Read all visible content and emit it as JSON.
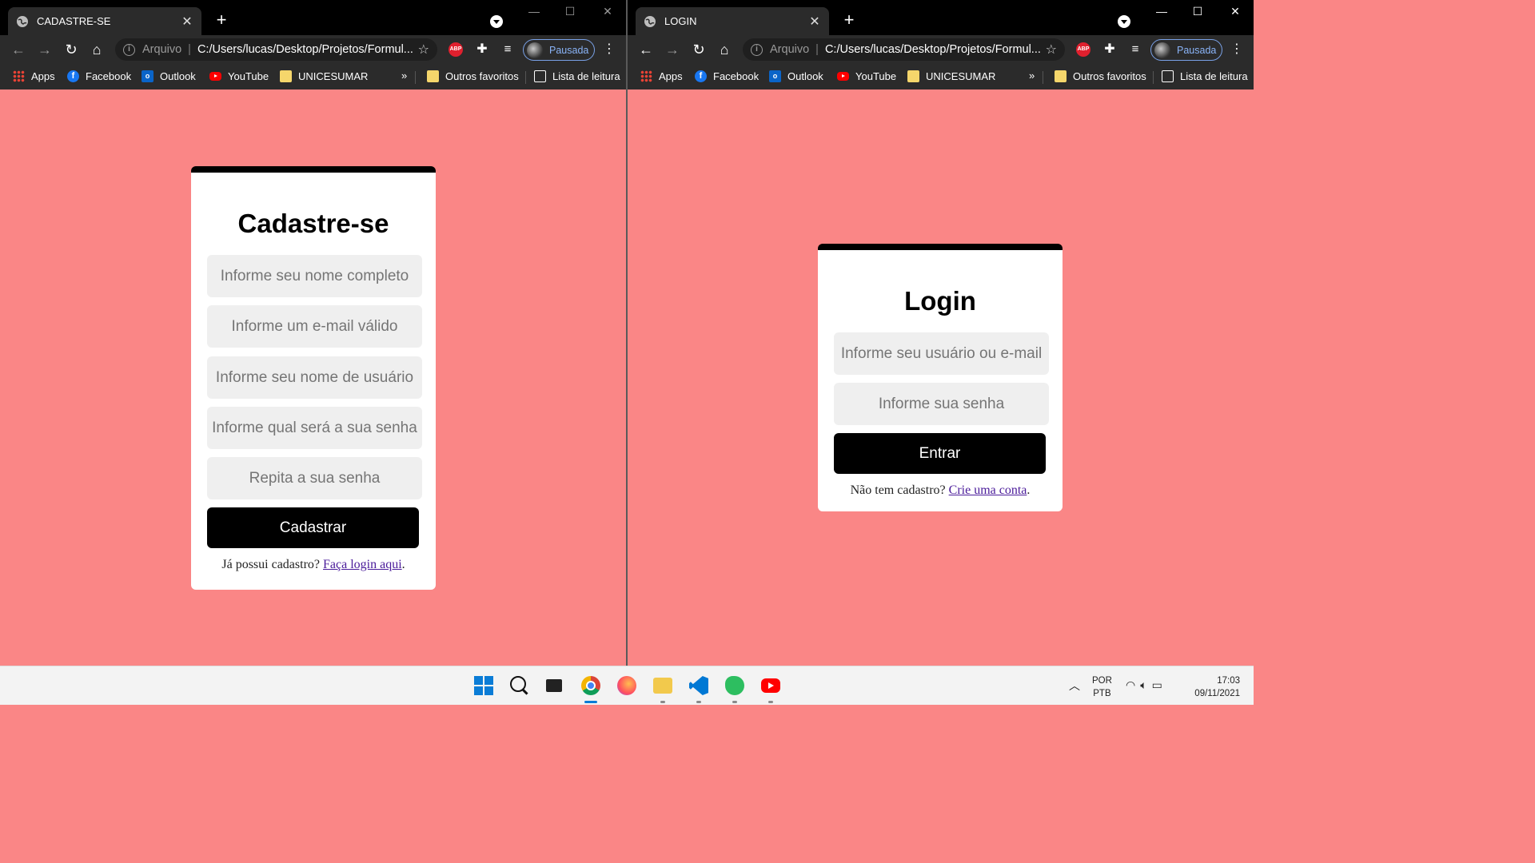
{
  "left_window": {
    "tab_title": "CADASTRE-SE",
    "address": {
      "scheme": "Arquivo",
      "url": "C:/Users/lucas/Desktop/Projetos/Formul..."
    },
    "profile_label": "Pausada",
    "bookmarks": [
      "Apps",
      "Facebook",
      "Outlook",
      "YouTube",
      "UNICESUMAR"
    ],
    "bookmarks_more": "»",
    "other_bookmarks": "Outros favoritos",
    "reading_list": "Lista de leitura",
    "form": {
      "title": "Cadastre-se",
      "fields": [
        {
          "placeholder": "Informe seu nome completo"
        },
        {
          "placeholder": "Informe um e-mail válido"
        },
        {
          "placeholder": "Informe seu nome de usuário"
        },
        {
          "placeholder": "Informe qual será a sua senha"
        },
        {
          "placeholder": "Repita a sua senha"
        }
      ],
      "submit_label": "Cadastrar",
      "footer_text": "Já possui cadastro? ",
      "footer_link": "Faça login aqui",
      "footer_end": "."
    }
  },
  "right_window": {
    "tab_title": "LOGIN",
    "address": {
      "scheme": "Arquivo",
      "url": "C:/Users/lucas/Desktop/Projetos/Formul..."
    },
    "profile_label": "Pausada",
    "bookmarks": [
      "Apps",
      "Facebook",
      "Outlook",
      "YouTube",
      "UNICESUMAR"
    ],
    "bookmarks_more": "»",
    "other_bookmarks": "Outros favoritos",
    "reading_list": "Lista de leitura",
    "form": {
      "title": "Login",
      "fields": [
        {
          "placeholder": "Informe seu usuário ou e-mail"
        },
        {
          "placeholder": "Informe sua senha"
        }
      ],
      "submit_label": "Entrar",
      "footer_text": "Não tem cadastro? ",
      "footer_link": "Crie uma conta",
      "footer_end": "."
    }
  },
  "taskbar": {
    "lang_line1": "POR",
    "lang_line2": "PTB",
    "time": "17:03",
    "date": "09/11/2021"
  },
  "colors": {
    "page_background": "#fa8686",
    "button": "#000000",
    "link": "#4a1b9a"
  }
}
